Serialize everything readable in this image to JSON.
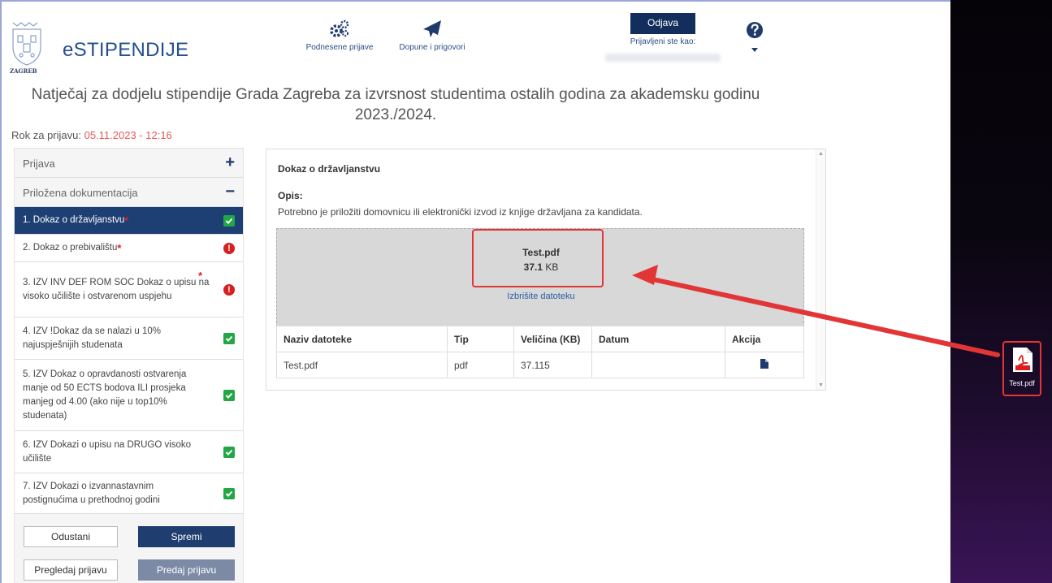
{
  "brand": {
    "name": "eSTIPENDIJE",
    "city_word": "ZAGREB"
  },
  "nav": {
    "podnesene": "Podnesene prijave",
    "dopune": "Dopune i prigovori",
    "logout": "Odjava",
    "logged_in_as": "Prijavljeni ste kao:"
  },
  "page": {
    "title": "Natječaj za dodjelu stipendije Grada Zagreba za izvrsnost studentima ostalih godina za akademsku godinu 2023./2024.",
    "deadline_label": "Rok za prijavu: ",
    "deadline_value": "05.11.2023 - 12:16"
  },
  "sidebar": {
    "section_prijava": "Prijava",
    "section_docs": "Priložena dokumentacija",
    "items": [
      {
        "label": "1. Dokaz o državljanstvu",
        "required": true,
        "status": "ok"
      },
      {
        "label": "2. Dokaz o prebivalištu",
        "required": true,
        "status": "error"
      },
      {
        "label": "3. IZV INV DEF ROM SOC Dokaz o upisu na visoko učilište i ostvarenom uspjehu",
        "required": true,
        "status": "error"
      },
      {
        "label": "4. IZV !Dokaz da se nalazi u 10% najuspješnijih studenata",
        "required": false,
        "status": "ok"
      },
      {
        "label": "5. IZV Dokaz o opravdanosti ostvarenja manje od 50 ECTS bodova ILI prosjeka manjeg od 4.00 (ako nije u top10% studenata)",
        "required": false,
        "status": "ok"
      },
      {
        "label": "6. IZV Dokazi o upisu na DRUGO visoko učilište",
        "required": false,
        "status": "ok"
      },
      {
        "label": "7. IZV Dokazi o izvannastavnim postignućima u prethodnoj godini",
        "required": false,
        "status": "ok"
      }
    ],
    "buttons": {
      "cancel": "Odustani",
      "save": "Spremi",
      "review": "Pregledaj prijavu",
      "submit": "Predaj prijavu"
    }
  },
  "document": {
    "title": "Dokaz o državljanstvu",
    "opis_label": "Opis:",
    "opis_text": "Potrebno je priložiti domovnicu ili elektronički izvod iz knjige državljana za kandidata.",
    "uploaded": {
      "name": "Test.pdf",
      "size_value": "37.1",
      "size_unit": " KB",
      "delete": "Izbrišite datoteku"
    },
    "table": {
      "headers": [
        "Naziv datoteke",
        "Tip",
        "Veličina (KB)",
        "Datum",
        "Akcija"
      ],
      "rows": [
        [
          "Test.pdf",
          "pdf",
          "37.115",
          ""
        ]
      ]
    }
  },
  "desktop": {
    "file_label": "Test.pdf"
  },
  "colors": {
    "navy": "#1e3f73",
    "accent_red": "#e23636",
    "ok_green": "#22a745"
  }
}
